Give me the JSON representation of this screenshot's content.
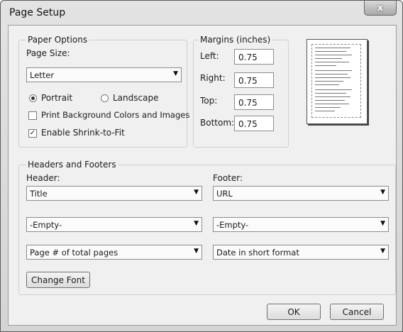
{
  "window": {
    "title": "Page Setup",
    "close_label": "x"
  },
  "paper_options": {
    "group_label": "Paper Options",
    "page_size_label": "Page Size:",
    "page_size_value": "Letter",
    "orientation": [
      {
        "label": "Portrait",
        "selected": true
      },
      {
        "label": "Landscape",
        "selected": false
      }
    ],
    "print_background_label": "Print Background Colors and Images",
    "print_background_checked": false,
    "shrink_label": "Enable Shrink-to-Fit",
    "shrink_checked": true
  },
  "margins": {
    "group_label": "Margins (inches)",
    "fields": [
      {
        "label": "Left:",
        "value": "0.75"
      },
      {
        "label": "Right:",
        "value": "0.75"
      },
      {
        "label": "Top:",
        "value": "0.75"
      },
      {
        "label": "Bottom:",
        "value": "0.75"
      }
    ]
  },
  "headers_footers": {
    "group_label": "Headers and Footers",
    "header_label": "Header:",
    "footer_label": "Footer:",
    "header_values": [
      "Title",
      "-Empty-",
      "Page # of total pages"
    ],
    "footer_values": [
      "URL",
      "-Empty-",
      "Date in short format"
    ],
    "change_font_label": "Change Font"
  },
  "buttons": {
    "ok_label": "OK",
    "cancel_label": "Cancel"
  }
}
